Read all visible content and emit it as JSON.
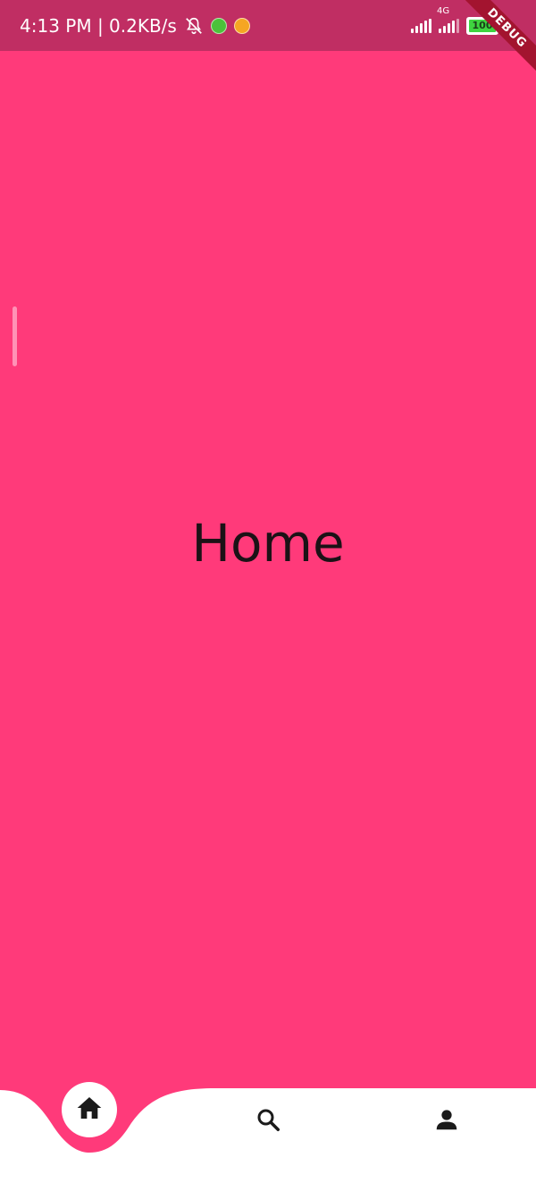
{
  "status_bar": {
    "time_speed": "4:13 PM | 0.2KB/s",
    "network_type": "4G",
    "battery_level": "100",
    "background_color": "#C02E63"
  },
  "debug_banner": {
    "label": "DEBUG",
    "color": "#A3142F"
  },
  "page": {
    "title": "Home",
    "background_color": "#FF3A7A"
  },
  "bottom_nav": {
    "items": [
      {
        "icon": "home-icon",
        "selected": true
      },
      {
        "icon": "search-icon",
        "selected": false
      },
      {
        "icon": "person-icon",
        "selected": false
      }
    ],
    "background_color": "#FFFFFF"
  }
}
